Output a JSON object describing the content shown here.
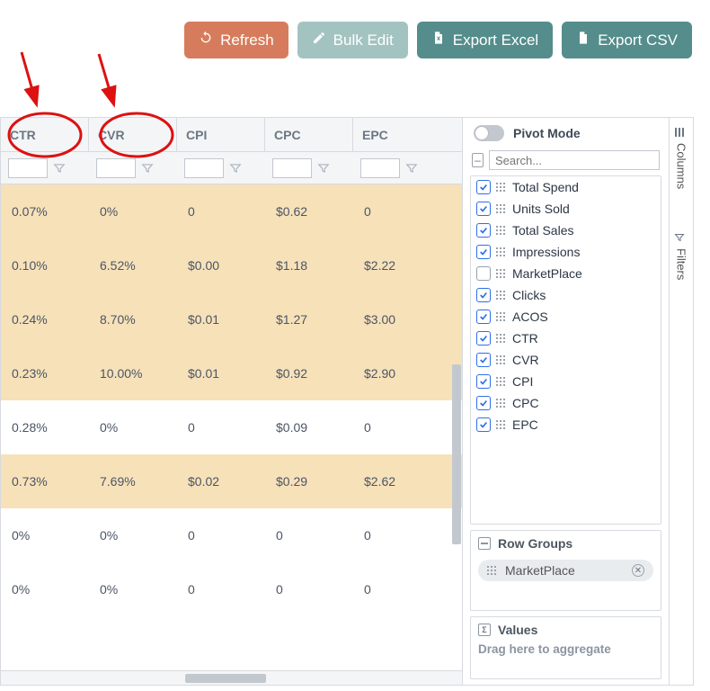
{
  "toolbar": {
    "refresh": "Refresh",
    "bulk_edit": "Bulk Edit",
    "export_excel": "Export Excel",
    "export_csv": "Export CSV"
  },
  "table": {
    "columns": [
      "CTR",
      "CVR",
      "CPI",
      "CPC",
      "EPC"
    ],
    "rows": [
      {
        "hl": true,
        "cells": [
          "0.07%",
          "0%",
          "0",
          "$0.62",
          "0"
        ]
      },
      {
        "hl": true,
        "cells": [
          "0.10%",
          "6.52%",
          "$0.00",
          "$1.18",
          "$2.22"
        ]
      },
      {
        "hl": true,
        "cells": [
          "0.24%",
          "8.70%",
          "$0.01",
          "$1.27",
          "$3.00"
        ]
      },
      {
        "hl": true,
        "cells": [
          "0.23%",
          "10.00%",
          "$0.01",
          "$0.92",
          "$2.90"
        ]
      },
      {
        "hl": false,
        "cells": [
          "0.28%",
          "0%",
          "0",
          "$0.09",
          "0"
        ]
      },
      {
        "hl": true,
        "cells": [
          "0.73%",
          "7.69%",
          "$0.02",
          "$0.29",
          "$2.62"
        ]
      },
      {
        "hl": false,
        "cells": [
          "0%",
          "0%",
          "0",
          "0",
          "0"
        ]
      },
      {
        "hl": false,
        "cells": [
          "0%",
          "0%",
          "0",
          "0",
          "0"
        ]
      }
    ]
  },
  "side": {
    "pivot_label": "Pivot Mode",
    "pivot_on": false,
    "search_placeholder": "Search...",
    "columns_tab": "Columns",
    "filters_tab": "Filters",
    "column_list": [
      {
        "label": "Total Spend",
        "checked": true
      },
      {
        "label": "Units Sold",
        "checked": true
      },
      {
        "label": "Total Sales",
        "checked": true
      },
      {
        "label": "Impressions",
        "checked": true
      },
      {
        "label": "MarketPlace",
        "checked": false
      },
      {
        "label": "Clicks",
        "checked": true
      },
      {
        "label": "ACOS",
        "checked": true
      },
      {
        "label": "CTR",
        "checked": true
      },
      {
        "label": "CVR",
        "checked": true
      },
      {
        "label": "CPI",
        "checked": true
      },
      {
        "label": "CPC",
        "checked": true
      },
      {
        "label": "EPC",
        "checked": true
      }
    ],
    "row_groups_title": "Row Groups",
    "row_group_chip": "MarketPlace",
    "values_title": "Values",
    "values_placeholder": "Drag here to aggregate"
  }
}
